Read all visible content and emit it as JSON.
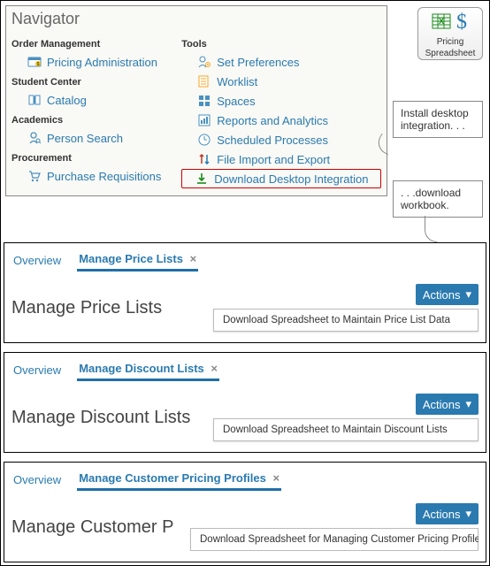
{
  "navigator": {
    "title": "Navigator",
    "left": {
      "order_mgmt": {
        "hdr": "Order Management",
        "pricing_admin": "Pricing Administration"
      },
      "student": {
        "hdr": "Student Center",
        "catalog": "Catalog"
      },
      "academics": {
        "hdr": "Academics",
        "person_search": "Person Search"
      },
      "procurement": {
        "hdr": "Procurement",
        "purchase_req": "Purchase Requisitions"
      }
    },
    "right": {
      "hdr": "Tools",
      "set_prefs": "Set Preferences",
      "worklist": "Worklist",
      "spaces": "Spaces",
      "reports": "Reports and Analytics",
      "sched": "Scheduled Processes",
      "file_io": "File Import and Export",
      "download": "Download Desktop Integration"
    }
  },
  "spreadsheet_btn": {
    "label1": "Pricing",
    "label2": "Spreadsheet"
  },
  "callouts": {
    "install": "Install desktop integration. . .",
    "download": ". . .download workbook."
  },
  "panels": [
    {
      "tabs": {
        "overview": "Overview",
        "active": "Manage Price Lists"
      },
      "title": "Manage Price Lists",
      "actions": "Actions",
      "item": "Download Spreadsheet to Maintain Price List Data"
    },
    {
      "tabs": {
        "overview": "Overview",
        "active": "Manage Discount Lists"
      },
      "title": "Manage Discount Lists",
      "actions": "Actions",
      "item": "Download Spreadsheet to Maintain Discount Lists"
    },
    {
      "tabs": {
        "overview": "Overview",
        "active": "Manage Customer Pricing Profiles"
      },
      "title": "Manage Customer P",
      "actions": "Actions",
      "item": "Download Spreadsheet for Managing Customer Pricing Profile"
    }
  ]
}
